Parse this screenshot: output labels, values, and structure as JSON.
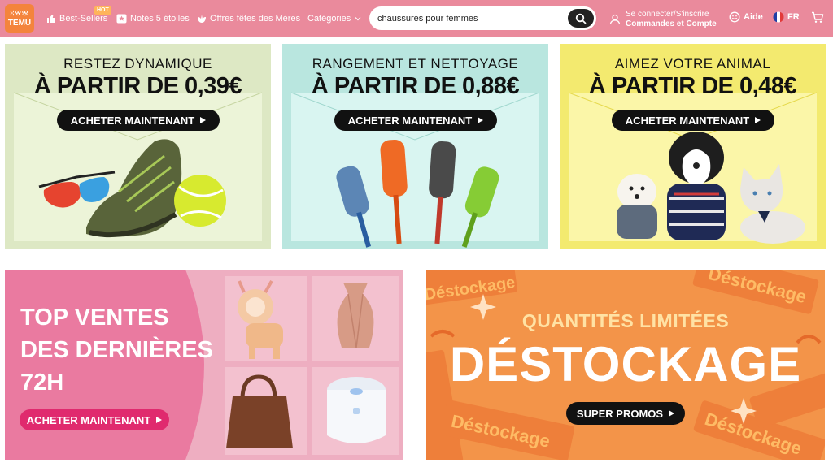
{
  "header": {
    "logo_top": "ꔘꕢꕣ",
    "logo_bottom": "TEMU",
    "nav": [
      {
        "label": "Best-Sellers",
        "badge": "HOT",
        "icon": "thumbs-up-icon"
      },
      {
        "label": "Notés 5 étoiles",
        "icon": "star-box-icon"
      },
      {
        "label": "Offres fêtes des Mères",
        "icon": "flower-icon"
      },
      {
        "label": "Catégories",
        "icon": "chevron-down-icon"
      }
    ],
    "search": {
      "value": "chaussures pour femmes",
      "icon": "search-icon"
    },
    "account": {
      "line1": "Se connecter/S'inscrire",
      "line2": "Commandes et Compte",
      "icon": "user-icon"
    },
    "help": {
      "label": "Aide",
      "icon": "smile-icon"
    },
    "language": {
      "label": "FR",
      "icon": "flag-fr-icon"
    },
    "cart_icon": "cart-icon",
    "color": "#ea8a9c"
  },
  "banners": [
    {
      "title": "RESTEZ DYNAMIQUE",
      "price": "À PARTIR DE 0,39€",
      "cta": "ACHETER MAINTENANT",
      "color": "#dde8c4"
    },
    {
      "title": "RANGEMENT ET NETTOYAGE",
      "price": "À PARTIR DE 0,88€",
      "cta": "ACHETER MAINTENANT",
      "color": "#b9e6df"
    },
    {
      "title": "AIMEZ VOTRE ANIMAL",
      "price": "À PARTIR DE 0,48€",
      "cta": "ACHETER MAINTENANT",
      "color": "#f3ea6f"
    }
  ],
  "promo_left": {
    "headline": [
      "TOP VENTES",
      "DES DERNIÈRES",
      "72H"
    ],
    "cta": "ACHETER MAINTENANT",
    "color": "#eeaec1"
  },
  "promo_right": {
    "subtitle": "QUANTITÉS LIMITÉES",
    "title": "DÉSTOCKAGE",
    "cta": "SUPER PROMOS",
    "watermark": "Déstockage",
    "color": "#f39449"
  }
}
